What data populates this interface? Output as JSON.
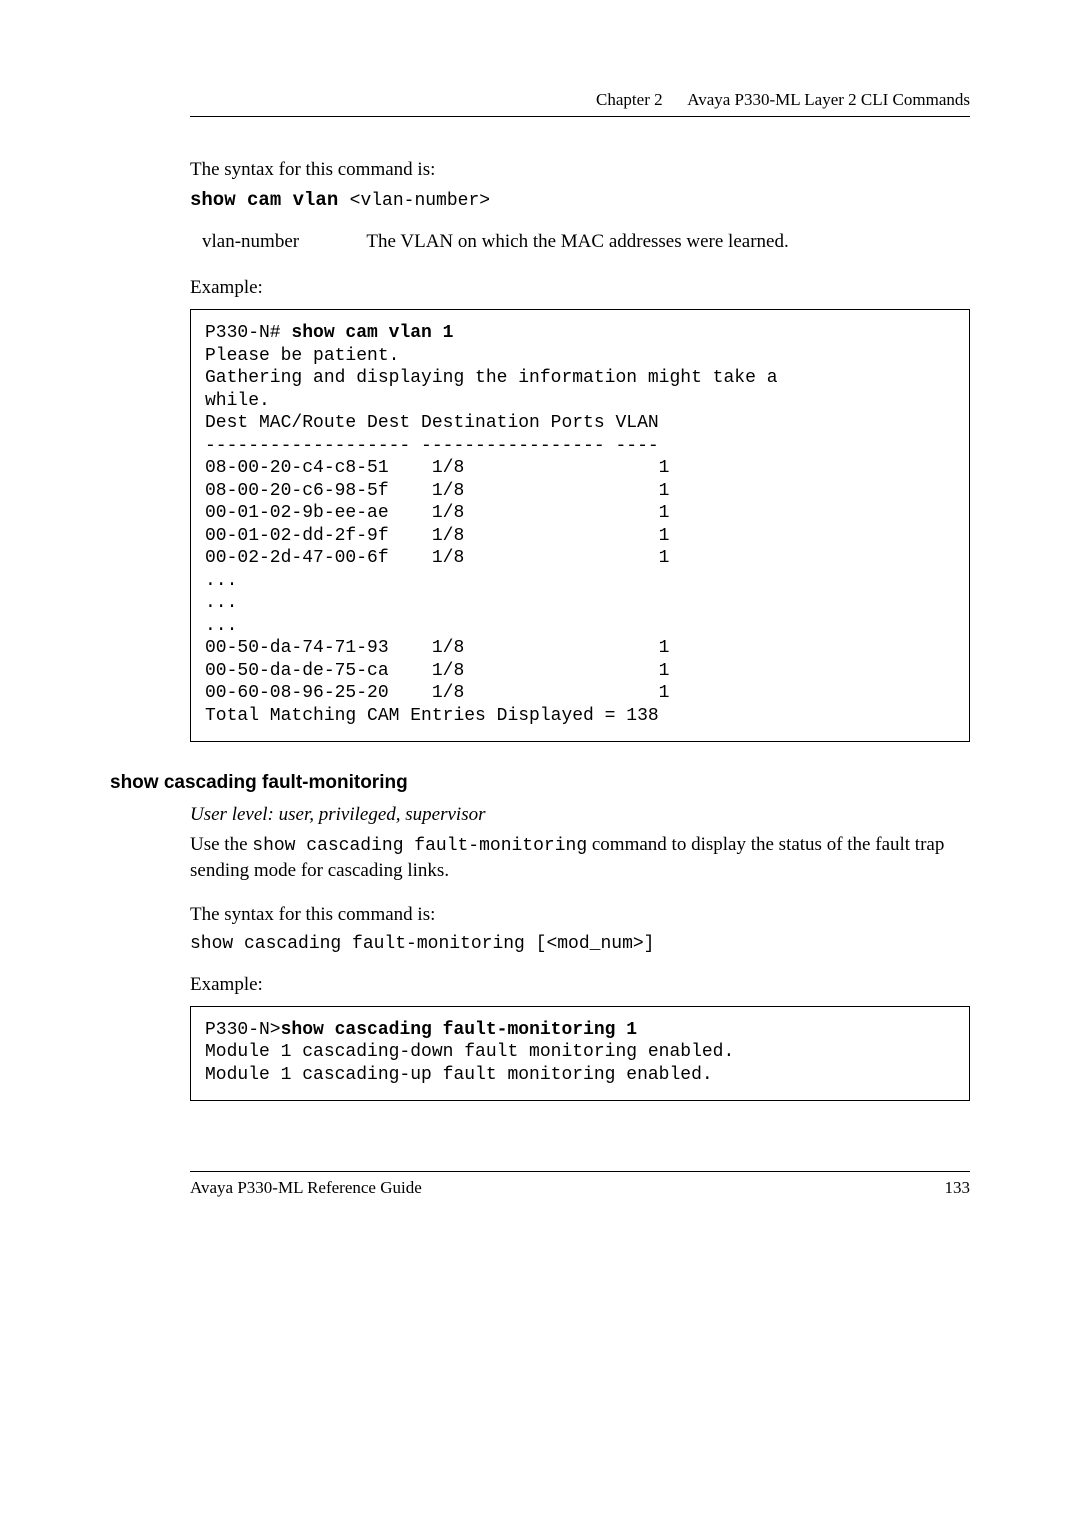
{
  "header": {
    "chapter": "Chapter 2",
    "title": "Avaya P330-ML Layer 2 CLI Commands"
  },
  "syntax_intro": "The syntax for this command is:",
  "cmd1_bold": "show cam vlan ",
  "cmd1_arg": "<vlan-number>",
  "param": {
    "name": "vlan-number",
    "desc": "The VLAN on which the MAC addresses were learned."
  },
  "example_label": "Example:",
  "codebox1": {
    "prompt": "P330-N# ",
    "cmd": "show cam vlan 1",
    "lines": [
      "Please be patient.",
      "Gathering and displaying the information might take a",
      "while.",
      "Dest MAC/Route Dest Destination Ports VLAN",
      "------------------- ----------------- ----",
      "08-00-20-c4-c8-51    1/8                  1",
      "08-00-20-c6-98-5f    1/8                  1",
      "00-01-02-9b-ee-ae    1/8                  1",
      "00-01-02-dd-2f-9f    1/8                  1",
      "00-02-2d-47-00-6f    1/8                  1",
      "...",
      "...",
      "...",
      "00-50-da-74-71-93    1/8                  1",
      "00-50-da-de-75-ca    1/8                  1",
      "00-60-08-96-25-20    1/8                  1",
      "Total Matching CAM Entries Displayed = 138"
    ]
  },
  "section2": {
    "heading": "show cascading fault-monitoring",
    "userlevel": "User level: user, privileged, supervisor",
    "desc_pre": "Use the ",
    "desc_cmd": "show cascading fault-monitoring",
    "desc_post": " command to display the status of the fault trap sending mode for cascading links.",
    "syntax_intro": "The syntax for this command is:",
    "syntax_line": "show cascading fault-monitoring [<mod_num>]",
    "example_label": "Example:"
  },
  "codebox2": {
    "prompt": "P330-N>",
    "cmd": "show cascading fault-monitoring 1",
    "lines": [
      "Module 1 cascading-down fault monitoring enabled.",
      "Module 1 cascading-up fault monitoring enabled."
    ]
  },
  "footer": {
    "left": "Avaya P330-ML Reference Guide",
    "right": "133"
  }
}
